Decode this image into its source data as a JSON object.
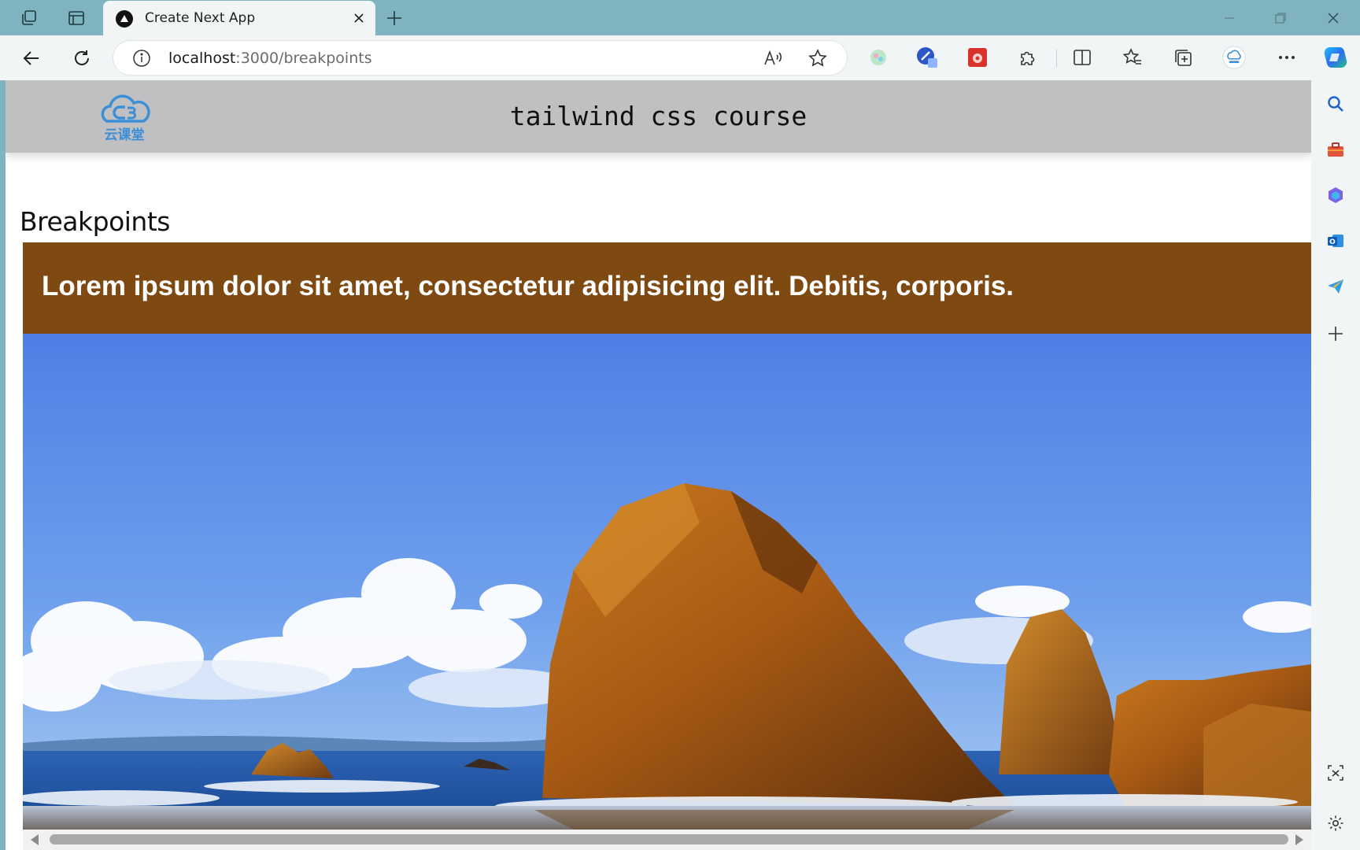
{
  "browser": {
    "tab": {
      "title": "Create Next App"
    },
    "address": {
      "host": "localhost",
      "path": ":3000/breakpoints"
    },
    "icons": {
      "workspaces": "workspaces-icon",
      "tab_actions": "tab-actions-icon",
      "new_tab": "plus-icon",
      "back": "back-arrow-icon",
      "refresh": "refresh-icon",
      "site_info": "info-icon",
      "read_aloud": "read-aloud-icon",
      "favorite": "star-icon",
      "extensions": "puzzle-icon",
      "split_screen": "split-screen-icon",
      "favorites": "favorites-icon",
      "collections": "collections-icon",
      "more": "more-icon",
      "copilot": "copilot-icon"
    },
    "sidebar_icons": [
      "search-icon",
      "toolbox-icon",
      "copilot-app-icon",
      "outlook-icon",
      "send-icon",
      "plus-icon",
      "screenshot-icon",
      "gear-icon"
    ]
  },
  "page": {
    "header": {
      "title": "tailwind css course",
      "logo_text": "云课堂"
    },
    "heading": "Breakpoints",
    "banner": {
      "text": "Lorem ipsum dolor sit amet, consectetur adipisicing elit. Debitis, corporis."
    },
    "hero_image": {
      "subject": "coastal-rock-landscape-image"
    }
  },
  "colors": {
    "tabstrip": "#7fb3bf",
    "header_bg": "#c0bfc2",
    "banner_bg": "#7f4a12",
    "logo": "#3a8fd6"
  }
}
